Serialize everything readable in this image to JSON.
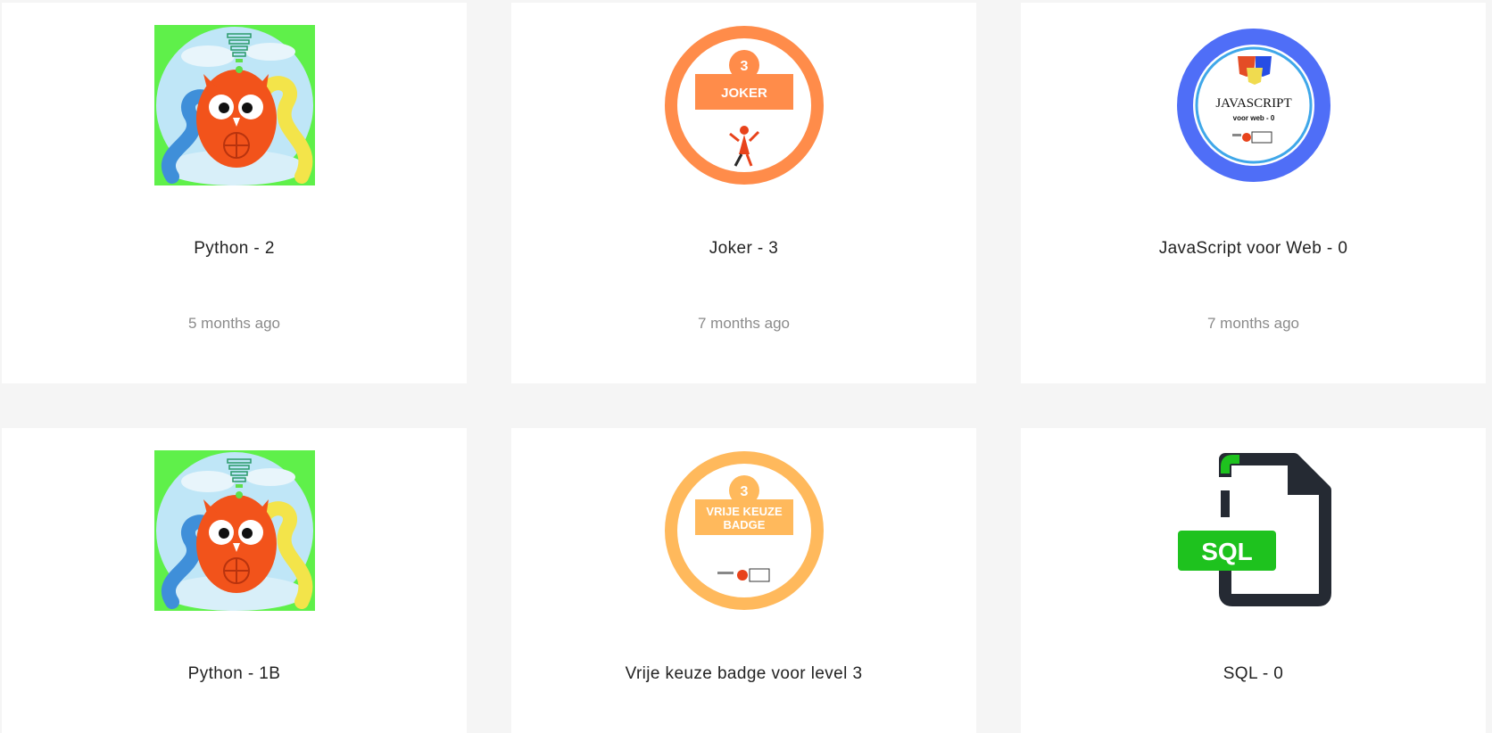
{
  "badges": [
    {
      "title": "Python - 2",
      "date": "5 months ago",
      "icon": "python-owl-icon"
    },
    {
      "title": "Joker - 3",
      "date": "7 months ago",
      "icon": "joker-badge-icon",
      "badge_text": "JOKER",
      "badge_number": "3",
      "color": "#ff8c4a"
    },
    {
      "title": "JavaScript voor Web - 0",
      "date": "7 months ago",
      "icon": "javascript-badge-icon",
      "badge_text": "JAVASCRIPT",
      "badge_sub": "voor web - 0",
      "color": "#4f6ef7"
    },
    {
      "title": "Python - 1B",
      "date": "",
      "icon": "python-owl-icon"
    },
    {
      "title": "Vrije keuze badge voor level 3",
      "date": "",
      "icon": "vrije-keuze-badge-icon",
      "badge_text_1": "VRIJE KEUZE",
      "badge_text_2": "BADGE",
      "badge_number": "3",
      "color": "#ffb95c"
    },
    {
      "title": "SQL - 0",
      "date": "",
      "icon": "sql-file-icon",
      "badge_text": "SQL",
      "color": "#1ec21e"
    }
  ]
}
